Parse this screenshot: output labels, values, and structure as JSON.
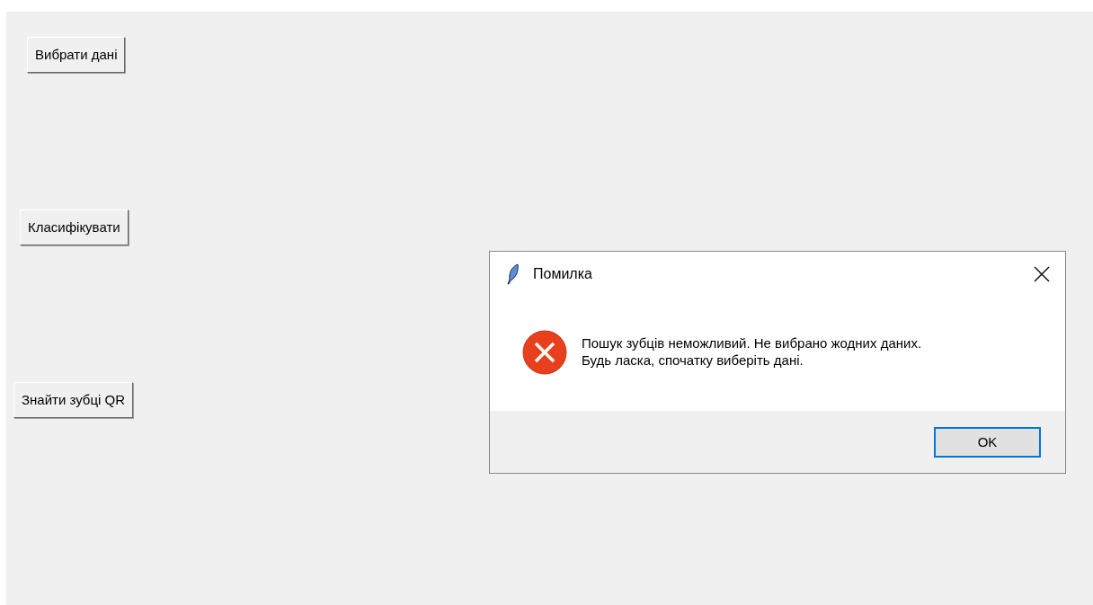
{
  "main_window": {
    "buttons": [
      {
        "label": "Вибрати дані"
      },
      {
        "label": "Класифікувати"
      },
      {
        "label": "Знайти зубці QR"
      }
    ]
  },
  "dialog": {
    "title": "Помилка",
    "message_lines": [
      "Пошук зубців неможливий. Не вибрано жодних даних.",
      "Будь ласка, спочатку виберіть дані."
    ],
    "ok_button": {
      "label": "OK",
      "focused": true
    }
  }
}
